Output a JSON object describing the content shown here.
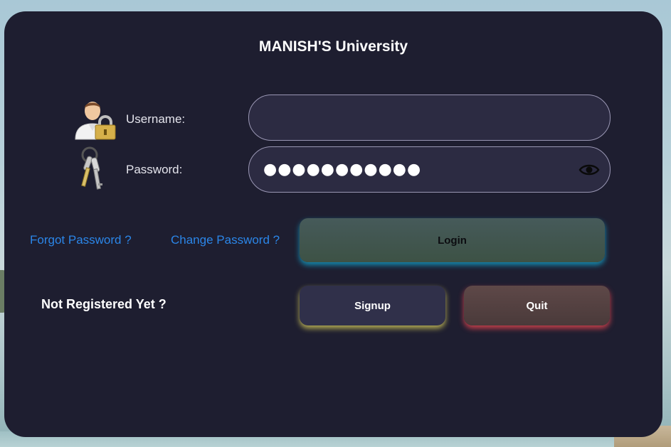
{
  "app": {
    "title": "MANISH'S University"
  },
  "form": {
    "username_label": "Username:",
    "password_label": "Password:",
    "username_value": "",
    "password_value": "●●●●●●●●●●●",
    "username_icon": "user-lock-icon",
    "password_icon": "keys-icon",
    "reveal_icon": "eye-icon"
  },
  "links": {
    "forgot_password": "Forgot Password ?",
    "change_password": "Change Password ?"
  },
  "buttons": {
    "login": "Login",
    "signup": "Signup",
    "quit": "Quit"
  },
  "register_prompt": "Not Registered Yet ?",
  "colors": {
    "panel": "#1e1e30",
    "link": "#2b86e8",
    "login_glow": "#14a0c8",
    "signup_glow": "#d2c85a",
    "quit_glow": "#e64650"
  }
}
